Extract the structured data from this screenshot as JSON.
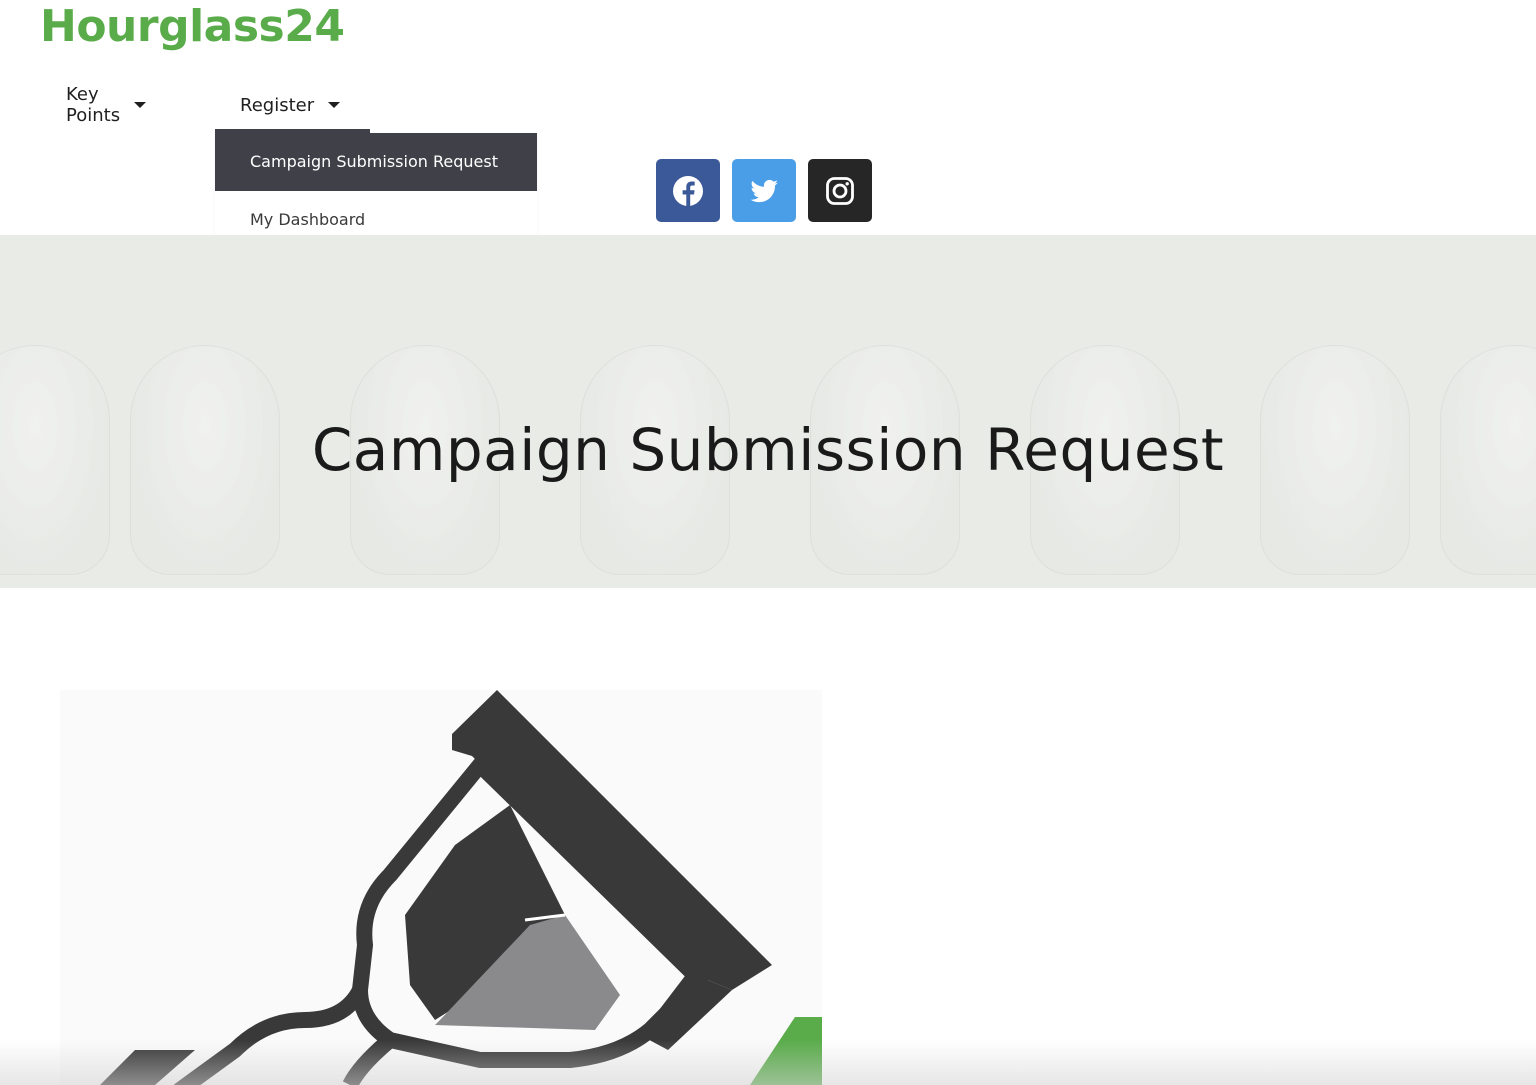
{
  "brand": {
    "name": "Hourglass24",
    "color": "#5aac4b"
  },
  "nav": {
    "items": [
      {
        "label": "Key Points",
        "icon": "caret-down-icon"
      },
      {
        "label": "Register",
        "icon": "caret-down-icon"
      }
    ],
    "register_dropdown": [
      {
        "label": "Campaign Submission Request",
        "active": true
      },
      {
        "label": "My Dashboard",
        "active": false
      }
    ]
  },
  "social": [
    {
      "name": "facebook",
      "icon": "facebook-icon",
      "color": "#3b5998"
    },
    {
      "name": "twitter",
      "icon": "twitter-icon",
      "color": "#4a9ee8"
    },
    {
      "name": "instagram",
      "icon": "instagram-icon",
      "color": "#262626"
    }
  ],
  "hero": {
    "title": "Campaign Submission Request",
    "background_color": "#e9ebe7"
  },
  "feature_image": {
    "icon": "hourglass-logo-icon",
    "accent_color": "#5aac4b"
  }
}
